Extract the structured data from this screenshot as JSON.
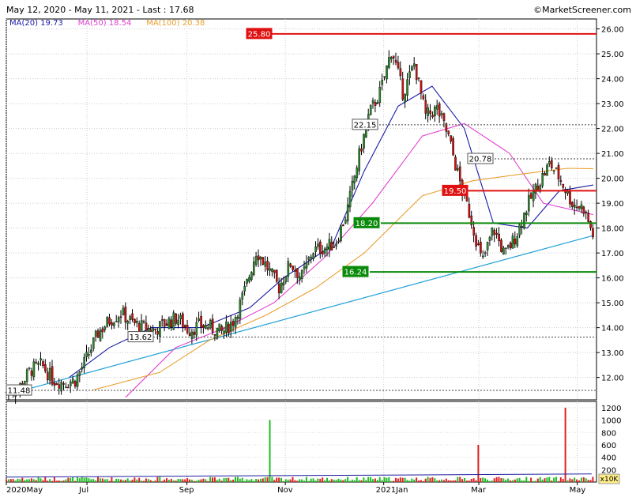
{
  "header": {
    "range_text": "May 12, 2020 - May 11, 2021 - Last : 17.68",
    "watermark": "©MarketScreener.com"
  },
  "legend": [
    {
      "label": "MA(20)",
      "value": "19.73",
      "color": "#1a1aa6"
    },
    {
      "label": "MA(50)",
      "value": "18.54",
      "color": "#e040d0"
    },
    {
      "label": "MA(100)",
      "value": "20.38",
      "color": "#e8a030"
    }
  ],
  "colors": {
    "up_candle": "#2e8b2e",
    "down_candle": "#d01010",
    "resistance": "#e01010",
    "support": "#0a8a0a",
    "trendline": "#20a0d8",
    "volume_up": "#22bb22",
    "volume_down": "#dd2222"
  },
  "chart_data": [
    {
      "type": "candlestick",
      "title": "",
      "x_ticks": [
        "2020May",
        "Jul",
        "Sep",
        "Nov",
        "2021Jan",
        "Mar",
        "May"
      ],
      "y_ticks": [
        "12.00",
        "13.00",
        "14.00",
        "15.00",
        "16.00",
        "17.00",
        "18.00",
        "19.00",
        "20.00",
        "21.00",
        "22.00",
        "23.00",
        "24.00",
        "25.00",
        "26.00"
      ],
      "ylim": [
        11.1,
        26.4
      ],
      "last": 17.68,
      "horizontal_levels": [
        {
          "label": "25.80",
          "value": 25.8,
          "style": "resistance"
        },
        {
          "label": "19.50",
          "value": 19.5,
          "style": "resistance"
        },
        {
          "label": "18.20",
          "value": 18.2,
          "style": "support"
        },
        {
          "label": "16.24",
          "value": 16.24,
          "style": "support"
        },
        {
          "label": "22.15",
          "value": 22.15,
          "style": "dotted"
        },
        {
          "label": "20.78",
          "value": 20.78,
          "style": "dotted"
        },
        {
          "label": "13.62",
          "value": 13.62,
          "style": "dotted"
        },
        {
          "label": "11.48",
          "value": 11.48,
          "style": "dotted"
        }
      ],
      "trendline": {
        "from": [
          "2020-05-12",
          11.3
        ],
        "to": [
          "2021-05-11",
          17.7
        ]
      },
      "close_path": [
        [
          "2020-05-12",
          11.4
        ],
        [
          "2020-05-20",
          11.6
        ],
        [
          "2020-05-27",
          12.3
        ],
        [
          "2020-06-03",
          12.5
        ],
        [
          "2020-06-10",
          11.9
        ],
        [
          "2020-06-17",
          11.8
        ],
        [
          "2020-06-24",
          11.9
        ],
        [
          "2020-07-01",
          12.8
        ],
        [
          "2020-07-08",
          13.8
        ],
        [
          "2020-07-15",
          14.3
        ],
        [
          "2020-07-22",
          14.6
        ],
        [
          "2020-07-29",
          14.2
        ],
        [
          "2020-08-05",
          14.0
        ],
        [
          "2020-08-12",
          13.9
        ],
        [
          "2020-08-19",
          14.2
        ],
        [
          "2020-08-26",
          14.4
        ],
        [
          "2020-09-02",
          13.9
        ],
        [
          "2020-09-09",
          14.1
        ],
        [
          "2020-09-16",
          14.0
        ],
        [
          "2020-09-23",
          13.8
        ],
        [
          "2020-09-30",
          14.3
        ],
        [
          "2020-10-07",
          15.5
        ],
        [
          "2020-10-14",
          17.1
        ],
        [
          "2020-10-21",
          16.4
        ],
        [
          "2020-10-28",
          15.6
        ],
        [
          "2020-11-04",
          16.6
        ],
        [
          "2020-11-11",
          16.0
        ],
        [
          "2020-11-18",
          17.1
        ],
        [
          "2020-11-25",
          17.2
        ],
        [
          "2020-12-02",
          17.4
        ],
        [
          "2020-12-09",
          18.6
        ],
        [
          "2020-12-16",
          20.7
        ],
        [
          "2020-12-23",
          22.6
        ],
        [
          "2020-12-30",
          23.5
        ],
        [
          "2021-01-06",
          25.2
        ],
        [
          "2021-01-13",
          23.4
        ],
        [
          "2021-01-20",
          24.6
        ],
        [
          "2021-01-27",
          22.5
        ],
        [
          "2021-02-03",
          22.8
        ],
        [
          "2021-02-10",
          21.7
        ],
        [
          "2021-02-17",
          19.9
        ],
        [
          "2021-02-24",
          18.4
        ],
        [
          "2021-03-03",
          16.6
        ],
        [
          "2021-03-10",
          18.0
        ],
        [
          "2021-03-17",
          16.9
        ],
        [
          "2021-03-24",
          17.7
        ],
        [
          "2021-03-31",
          18.9
        ],
        [
          "2021-04-07",
          19.8
        ],
        [
          "2021-04-14",
          20.6
        ],
        [
          "2021-04-21",
          19.9
        ],
        [
          "2021-04-28",
          19.0
        ],
        [
          "2021-05-05",
          18.8
        ],
        [
          "2021-05-11",
          17.68
        ]
      ],
      "moving_averages": [
        {
          "name": "MA(20)",
          "points": [
            [
              "2020-06-20",
              12.0
            ],
            [
              "2020-07-15",
              13.2
            ],
            [
              "2020-08-10",
              14.0
            ],
            [
              "2020-09-10",
              14.0
            ],
            [
              "2020-10-10",
              14.8
            ],
            [
              "2020-10-31",
              16.0
            ],
            [
              "2020-11-30",
              17.3
            ],
            [
              "2020-12-20",
              20.3
            ],
            [
              "2021-01-10",
              22.9
            ],
            [
              "2021-01-31",
              23.7
            ],
            [
              "2021-02-20",
              22.0
            ],
            [
              "2021-03-10",
              18.2
            ],
            [
              "2021-03-31",
              18.0
            ],
            [
              "2021-04-20",
              19.5
            ],
            [
              "2021-05-11",
              19.73
            ]
          ]
        },
        {
          "name": "MA(50)",
          "points": [
            [
              "2020-07-25",
              11.2
            ],
            [
              "2020-08-25",
              13.2
            ],
            [
              "2020-09-25",
              14.0
            ],
            [
              "2020-10-25",
              15.0
            ],
            [
              "2020-11-25",
              16.8
            ],
            [
              "2020-12-25",
              19.0
            ],
            [
              "2021-01-25",
              21.7
            ],
            [
              "2021-02-20",
              22.2
            ],
            [
              "2021-03-20",
              21.0
            ],
            [
              "2021-04-10",
              19.0
            ],
            [
              "2021-05-11",
              18.54
            ]
          ]
        },
        {
          "name": "MA(100)",
          "points": [
            [
              "2020-07-05",
              11.5
            ],
            [
              "2020-08-15",
              12.2
            ],
            [
              "2020-09-15",
              13.5
            ],
            [
              "2020-10-20",
              14.5
            ],
            [
              "2020-11-20",
              15.6
            ],
            [
              "2020-12-20",
              17.0
            ],
            [
              "2021-01-25",
              19.3
            ],
            [
              "2021-02-25",
              19.9
            ],
            [
              "2021-03-31",
              20.2
            ],
            [
              "2021-04-25",
              20.4
            ],
            [
              "2021-05-11",
              20.38
            ]
          ]
        }
      ]
    },
    {
      "type": "bar",
      "title": "",
      "unit_label": "x10K",
      "y_ticks": [
        "200",
        "400",
        "600",
        "800",
        "1000",
        "1200"
      ],
      "ylim": [
        0,
        1250
      ],
      "spikes": [
        [
          "2020-10-22",
          1000
        ],
        [
          "2021-03-01",
          600
        ],
        [
          "2021-04-23",
          1200
        ]
      ],
      "typical_volume": 50
    }
  ]
}
